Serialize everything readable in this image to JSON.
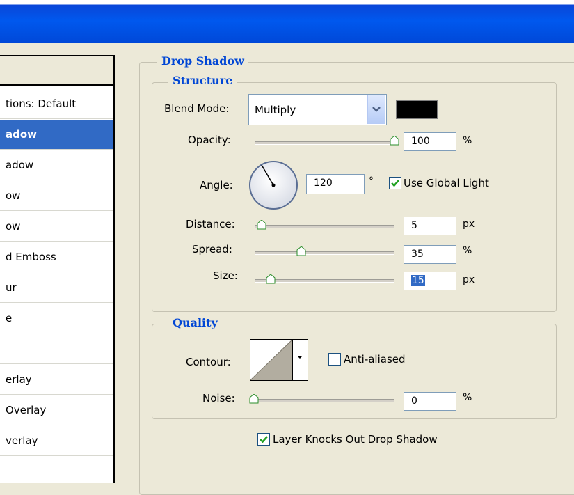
{
  "styles_list": {
    "items": [
      {
        "label": "tions: Default",
        "selected": false
      },
      {
        "label": "adow",
        "selected": true
      },
      {
        "label": "adow",
        "selected": false
      },
      {
        "label": "ow",
        "selected": false
      },
      {
        "label": "ow",
        "selected": false
      },
      {
        "label": "d Emboss",
        "selected": false
      },
      {
        "label": "ur",
        "selected": false
      },
      {
        "label": "e",
        "selected": false
      },
      {
        "label": "",
        "selected": false
      },
      {
        "label": "erlay",
        "selected": false
      },
      {
        "label": "Overlay",
        "selected": false
      },
      {
        "label": "verlay",
        "selected": false
      }
    ]
  },
  "drop_shadow": {
    "title": "Drop Shadow",
    "structure": {
      "title": "Structure",
      "blend_mode_label": "Blend Mode:",
      "blend_mode_value": "Multiply",
      "shadow_color": "#000000",
      "opacity_label": "Opacity:",
      "opacity_value": "100",
      "opacity_unit": "%",
      "opacity_level": 1.0,
      "angle_label": "Angle:",
      "angle_value": "120",
      "angle_unit": "°",
      "use_global_light_label": "Use Global Light",
      "use_global_light_checked": true,
      "distance_label": "Distance:",
      "distance_value": "5",
      "distance_unit": "px",
      "distance_level": 0.02,
      "spread_label": "Spread:",
      "spread_value": "35",
      "spread_unit": "%",
      "spread_level": 0.35,
      "size_label": "Size:",
      "size_value": "15",
      "size_unit": "px",
      "size_level": 0.06
    },
    "quality": {
      "title": "Quality",
      "contour_label": "Contour:",
      "anti_aliased_label": "Anti-aliased",
      "anti_aliased_checked": false,
      "noise_label": "Noise:",
      "noise_value": "0",
      "noise_unit": "%",
      "noise_level": 0.0
    },
    "layer_knocks_out_label": "Layer Knocks Out Drop Shadow",
    "layer_knocks_out_checked": true
  }
}
